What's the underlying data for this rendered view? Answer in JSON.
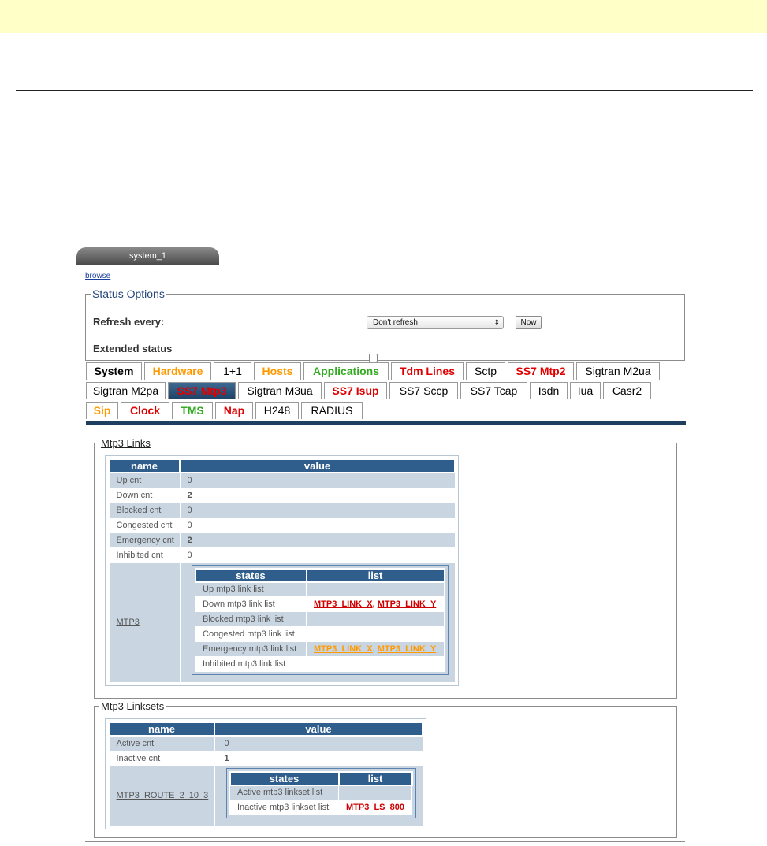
{
  "window": {
    "title": "system_1"
  },
  "browse_link": "browse",
  "status_options": {
    "legend": "Status Options",
    "refresh_label": "Refresh every:",
    "refresh_value": "Don't refresh",
    "now_button": "Now",
    "extended_label": "Extended status",
    "extended_checked": false
  },
  "tabs": {
    "row1": [
      {
        "label": "System",
        "color": "#000000"
      },
      {
        "label": "Hardware",
        "color": "#ff9900"
      },
      {
        "label": "1+1",
        "color": "#000000"
      },
      {
        "label": "Hosts",
        "color": "#ff9900"
      },
      {
        "label": "Applications",
        "color": "#33aa22"
      },
      {
        "label": "Tdm Lines",
        "color": "#e00000"
      },
      {
        "label": "Sctp",
        "color": "#000000"
      },
      {
        "label": "SS7 Mtp2",
        "color": "#e00000"
      },
      {
        "label": "Sigtran M2ua",
        "color": "#000000"
      }
    ],
    "row2": [
      {
        "label": "Sigtran M2pa",
        "color": "#000000"
      },
      {
        "label": "SS7 Mtp3",
        "color": "#e00000",
        "active": true
      },
      {
        "label": "Sigtran M3ua",
        "color": "#000000"
      },
      {
        "label": "SS7 Isup",
        "color": "#e00000"
      },
      {
        "label": "SS7 Sccp",
        "color": "#000000"
      },
      {
        "label": "SS7 Tcap",
        "color": "#000000"
      },
      {
        "label": "Isdn",
        "color": "#000000"
      },
      {
        "label": "Iua",
        "color": "#000000"
      },
      {
        "label": "Casr2",
        "color": "#000000"
      }
    ],
    "row3": [
      {
        "label": "Sip",
        "color": "#ff9900"
      },
      {
        "label": "Clock",
        "color": "#e00000"
      },
      {
        "label": "TMS",
        "color": "#33aa22"
      },
      {
        "label": "Nap",
        "color": "#e00000"
      },
      {
        "label": "H248",
        "color": "#000000"
      },
      {
        "label": "RADIUS",
        "color": "#000000"
      }
    ]
  },
  "links": {
    "legend": "Mtp3 Links",
    "headers": {
      "name": "name",
      "value": "value"
    },
    "rows": [
      {
        "name": "Up cnt",
        "value": "0"
      },
      {
        "name": "Down cnt",
        "value": "2"
      },
      {
        "name": "Blocked cnt",
        "value": "0"
      },
      {
        "name": "Congested cnt",
        "value": "0"
      },
      {
        "name": "Emergency cnt",
        "value": "2"
      },
      {
        "name": "Inhibited cnt",
        "value": "0"
      }
    ],
    "mtp3_label": "MTP3",
    "states_headers": {
      "states": "states",
      "list": "list"
    },
    "states": [
      {
        "state": "Up mtp3 link list"
      },
      {
        "state": "Down mtp3 link list"
      },
      {
        "state": "Blocked mtp3 link list"
      },
      {
        "state": "Congested mtp3 link list"
      },
      {
        "state": "Emergency mtp3 link list"
      },
      {
        "state": "Inhibited mtp3 link list"
      }
    ],
    "link_x": "MTP3_LINK_X",
    "link_y": "MTP3_LINK_Y",
    "separator": ", "
  },
  "linksets": {
    "legend": "Mtp3 Linksets",
    "headers": {
      "name": "name",
      "value": "value"
    },
    "rows": [
      {
        "name": "Active cnt",
        "value": "0"
      },
      {
        "name": "Inactive cnt",
        "value": "1"
      }
    ],
    "route_label": "MTP3_ROUTE_2_10_3",
    "states_headers": {
      "states": "states",
      "list": "list"
    },
    "states": [
      {
        "state": "Active mtp3 linkset list"
      },
      {
        "state": "Inactive mtp3 linkset list"
      }
    ],
    "linkset": "MTP3_LS_800"
  }
}
